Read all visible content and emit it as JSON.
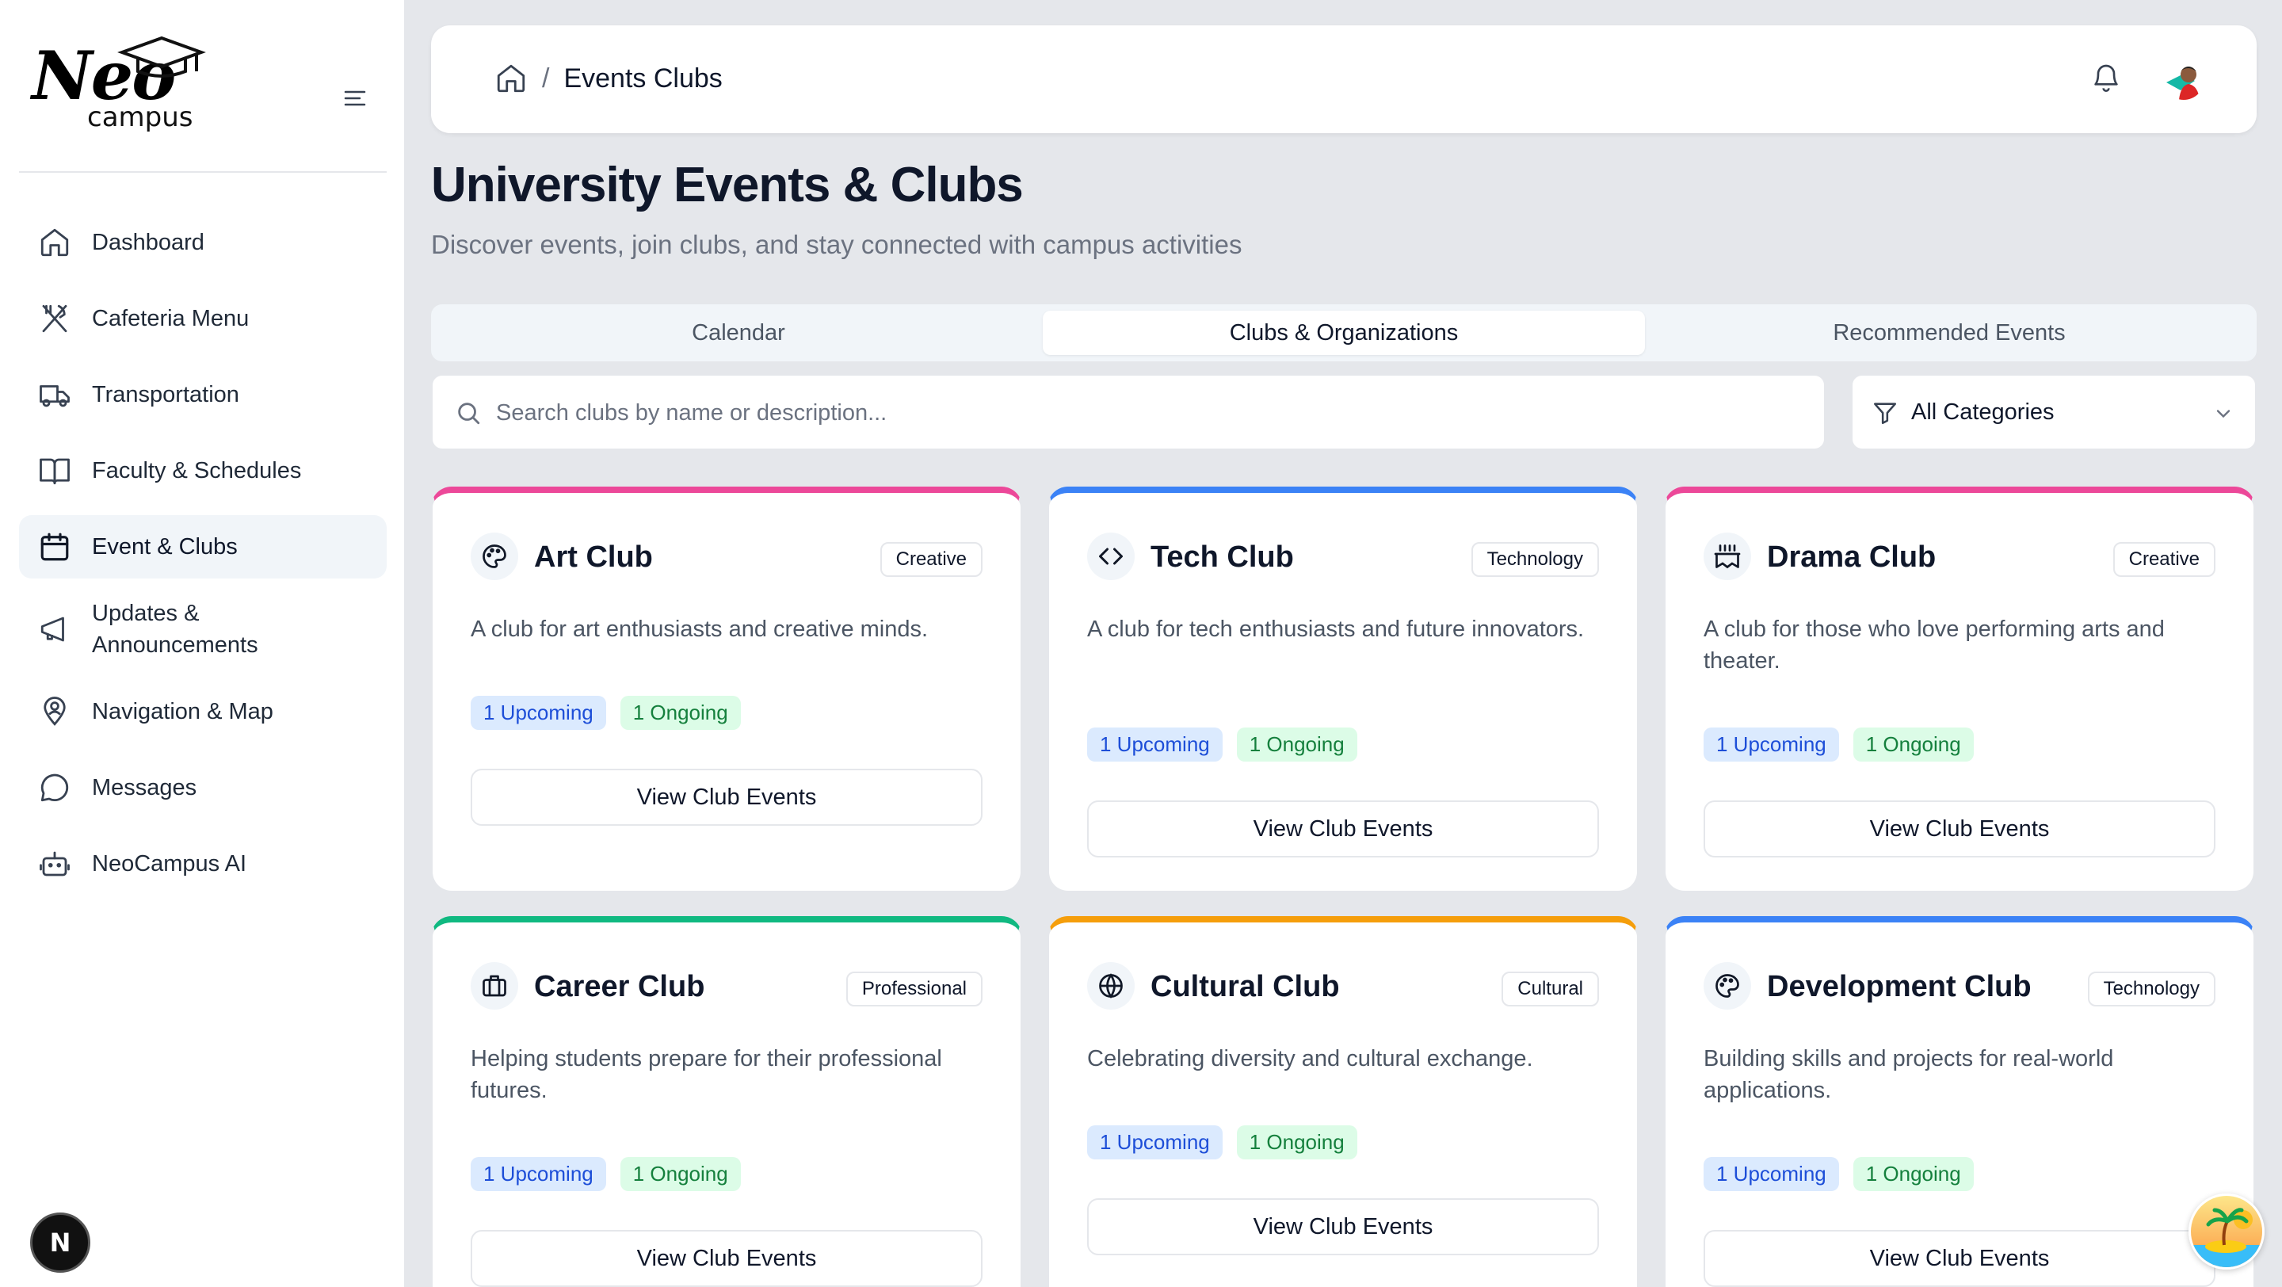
{
  "app": {
    "logo_main": "Neo",
    "logo_sub": "campus"
  },
  "sidebar": {
    "items": [
      {
        "label": "Dashboard",
        "icon": "home-icon"
      },
      {
        "label": "Cafeteria Menu",
        "icon": "utensils-icon"
      },
      {
        "label": "Transportation",
        "icon": "truck-icon"
      },
      {
        "label": "Faculty & Schedules",
        "icon": "book-open-icon"
      },
      {
        "label": "Event & Clubs",
        "icon": "calendar-icon",
        "active": true
      },
      {
        "label": "Updates & Announcements",
        "icon": "megaphone-icon"
      },
      {
        "label": "Navigation & Map",
        "icon": "map-pin-user-icon"
      },
      {
        "label": "Messages",
        "icon": "message-circle-icon"
      },
      {
        "label": "NeoCampus AI",
        "icon": "bot-icon"
      }
    ],
    "bottom_badge": "N"
  },
  "header": {
    "breadcrumb_separator": "/",
    "breadcrumb_current": "Events Clubs"
  },
  "page": {
    "title": "University Events & Clubs",
    "subtitle": "Discover events, join clubs, and stay connected with campus activities"
  },
  "tabs": [
    {
      "label": "Calendar",
      "active": false
    },
    {
      "label": "Clubs & Organizations",
      "active": true
    },
    {
      "label": "Recommended Events",
      "active": false
    }
  ],
  "search": {
    "placeholder": "Search clubs by name or description...",
    "value": ""
  },
  "filter": {
    "selected": "All Categories"
  },
  "colors": {
    "pink": "#ec4899",
    "blue": "#3b82f6",
    "green": "#10b981",
    "orange": "#f59e0b"
  },
  "clubs": [
    {
      "name": "Art Club",
      "category": "Creative",
      "description": "A club for art enthusiasts and creative minds.",
      "upcoming": "1 Upcoming",
      "ongoing": "1 Ongoing",
      "button": "View Club Events",
      "icon": "palette-icon",
      "accent": "#ec4899"
    },
    {
      "name": "Tech Club",
      "category": "Technology",
      "description": "A club for tech enthusiasts and future innovators.",
      "upcoming": "1 Upcoming",
      "ongoing": "1 Ongoing",
      "button": "View Club Events",
      "icon": "code-icon",
      "accent": "#3b82f6"
    },
    {
      "name": "Drama Club",
      "category": "Creative",
      "description": "A club for those who love performing arts and theater.",
      "upcoming": "1 Upcoming",
      "ongoing": "1 Ongoing",
      "button": "View Club Events",
      "icon": "theater-masks-icon",
      "accent": "#ec4899"
    },
    {
      "name": "Career Club",
      "category": "Professional",
      "description": "Helping students prepare for their professional futures.",
      "upcoming": "1 Upcoming",
      "ongoing": "1 Ongoing",
      "button": "View Club Events",
      "icon": "briefcase-icon",
      "accent": "#10b981"
    },
    {
      "name": "Cultural Club",
      "category": "Cultural",
      "description": "Celebrating diversity and cultural exchange.",
      "upcoming": "1 Upcoming",
      "ongoing": "1 Ongoing",
      "button": "View Club Events",
      "icon": "globe-icon",
      "accent": "#f59e0b"
    },
    {
      "name": "Development Club",
      "category": "Technology",
      "description": "Building skills and projects for real-world applications.",
      "upcoming": "1 Upcoming",
      "ongoing": "1 Ongoing",
      "button": "View Club Events",
      "icon": "palette-icon",
      "accent": "#3b82f6"
    }
  ]
}
